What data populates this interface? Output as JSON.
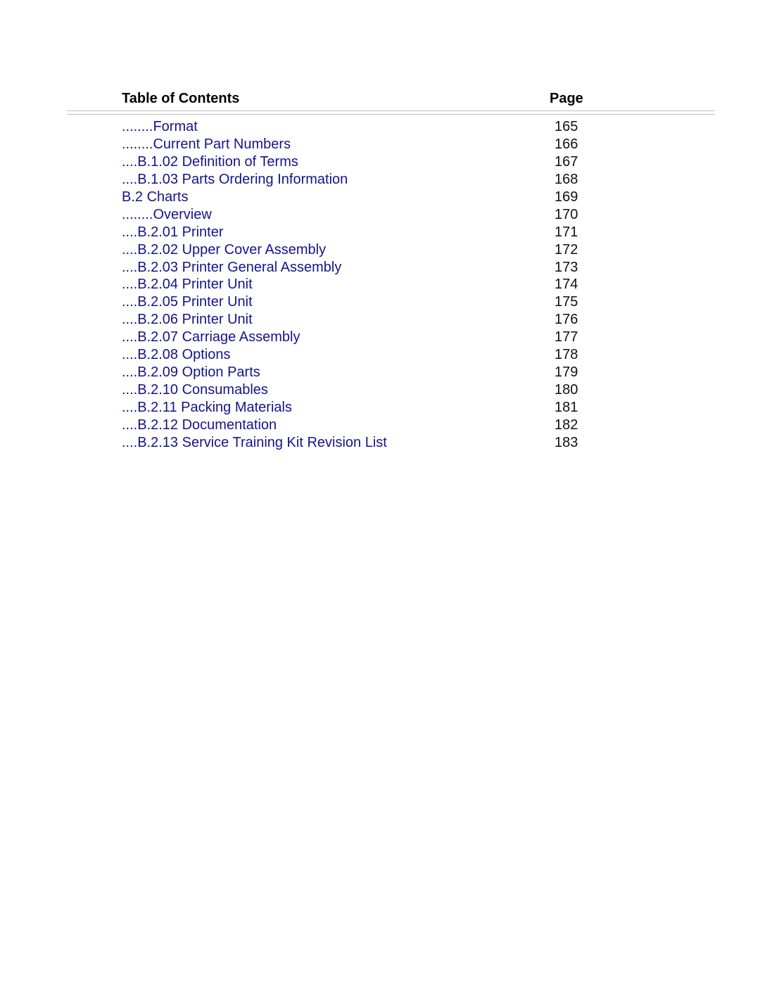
{
  "header": {
    "title": "Table of Contents",
    "page_label": "Page"
  },
  "link_color": "#14148c",
  "entries": [
    {
      "label": "........Format",
      "page": "165"
    },
    {
      "label": "........Current Part Numbers",
      "page": "166"
    },
    {
      "label": "....B.1.02 Definition of Terms",
      "page": "167"
    },
    {
      "label": "....B.1.03 Parts Ordering Information",
      "page": "168"
    },
    {
      "label": "B.2 Charts",
      "page": "169"
    },
    {
      "label": "........Overview",
      "page": "170"
    },
    {
      "label": "....B.2.01 Printer",
      "page": "171"
    },
    {
      "label": "....B.2.02 Upper Cover Assembly",
      "page": "172"
    },
    {
      "label": "....B.2.03 Printer General Assembly",
      "page": "173"
    },
    {
      "label": "....B.2.04 Printer Unit",
      "page": "174"
    },
    {
      "label": "....B.2.05 Printer Unit",
      "page": "175"
    },
    {
      "label": "....B.2.06 Printer Unit",
      "page": "176"
    },
    {
      "label": "....B.2.07 Carriage Assembly",
      "page": "177"
    },
    {
      "label": "....B.2.08 Options",
      "page": "178"
    },
    {
      "label": "....B.2.09 Option Parts",
      "page": "179"
    },
    {
      "label": "....B.2.10 Consumables",
      "page": "180"
    },
    {
      "label": "....B.2.11 Packing Materials",
      "page": "181"
    },
    {
      "label": "....B.2.12 Documentation",
      "page": "182"
    },
    {
      "label": "....B.2.13 Service Training Kit Revision List",
      "page": "183"
    }
  ]
}
